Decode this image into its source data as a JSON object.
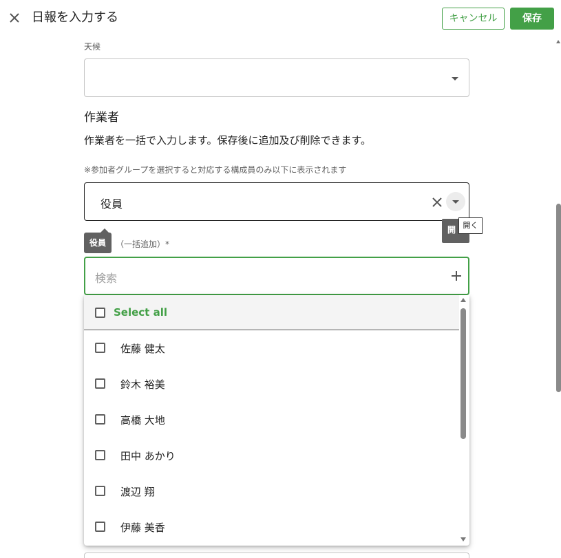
{
  "header": {
    "title": "日報を入力する",
    "cancel_label": "キャンセル",
    "save_label": "保存"
  },
  "weather": {
    "label": "天候",
    "value": ""
  },
  "workers_section": {
    "title": "作業者",
    "description": "作業者を一括で入力します。保存後に追加及び削除できます。",
    "note": "※参加者グループを選択すると対応する構成員のみ以下に表示されます",
    "group_value": "役員",
    "chip_tooltip": "役員",
    "worker_label": "（一括追加）*",
    "open_tooltip_dark": "開",
    "open_tooltip_light": "開く"
  },
  "search": {
    "placeholder": "検索"
  },
  "dropdown": {
    "select_all_label": "Select all",
    "items": [
      {
        "name": "佐藤 健太"
      },
      {
        "name": "鈴木 裕美"
      },
      {
        "name": "高橋 大地"
      },
      {
        "name": "田中 あかり"
      },
      {
        "name": "渡辺 翔"
      },
      {
        "name": "伊藤 美香"
      }
    ]
  },
  "colors": {
    "accent": "#43a047"
  }
}
